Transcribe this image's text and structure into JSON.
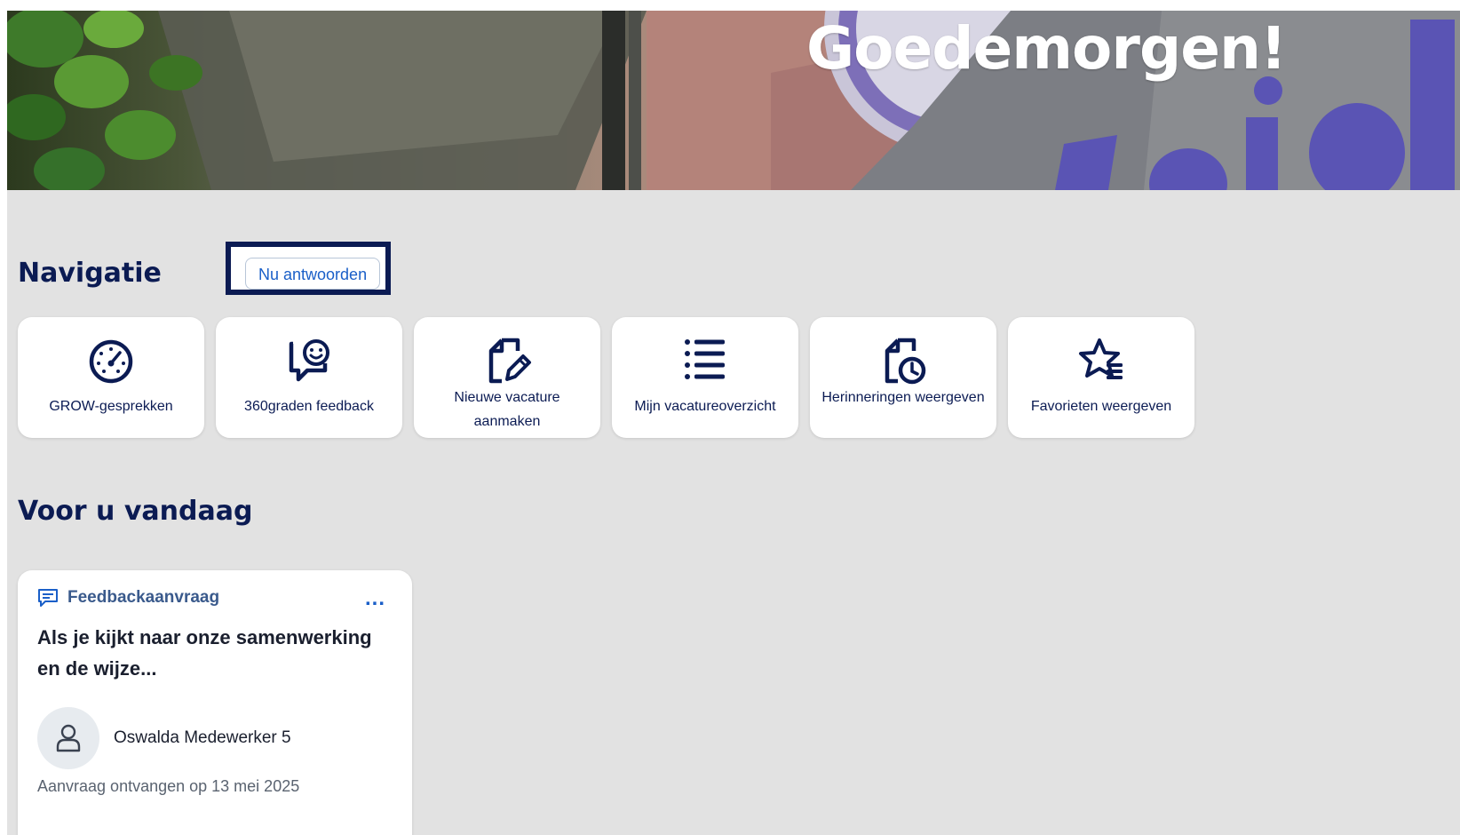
{
  "hero": {
    "greeting": "Goedemorgen!"
  },
  "navigation": {
    "title": "Navigatie",
    "tiles": [
      {
        "label": "GROW-gesprekken",
        "icon": "speedometer-icon"
      },
      {
        "label": "360graden feedback",
        "icon": "feedback-chat-icon"
      },
      {
        "label": "Nieuwe vacature aanmaken",
        "icon": "document-edit-icon"
      },
      {
        "label": "Mijn vacatureoverzicht",
        "icon": "list-icon"
      },
      {
        "label": "Herinneringen weergeven",
        "icon": "document-clock-icon"
      },
      {
        "label": "Favorieten weergeven",
        "icon": "star-list-icon"
      }
    ]
  },
  "today": {
    "title": "Voor u vandaag",
    "card": {
      "type_label": "Feedbackaanvraag",
      "type_icon": "comment-icon",
      "more_label": "...",
      "title": "Als je kijkt naar onze samenwerking en de wijze...",
      "person_name": "Oswalda Medewerker 5",
      "avatar_icon": "person-icon",
      "received_text": "Aanvraag ontvangen op 13 mei 2025",
      "action_label": "Nu antwoorden"
    }
  },
  "colors": {
    "page_background": "#e2e2e2",
    "heading": "#0b1b53",
    "accent_blue": "#1a5fc8",
    "card_background": "#ffffff"
  }
}
